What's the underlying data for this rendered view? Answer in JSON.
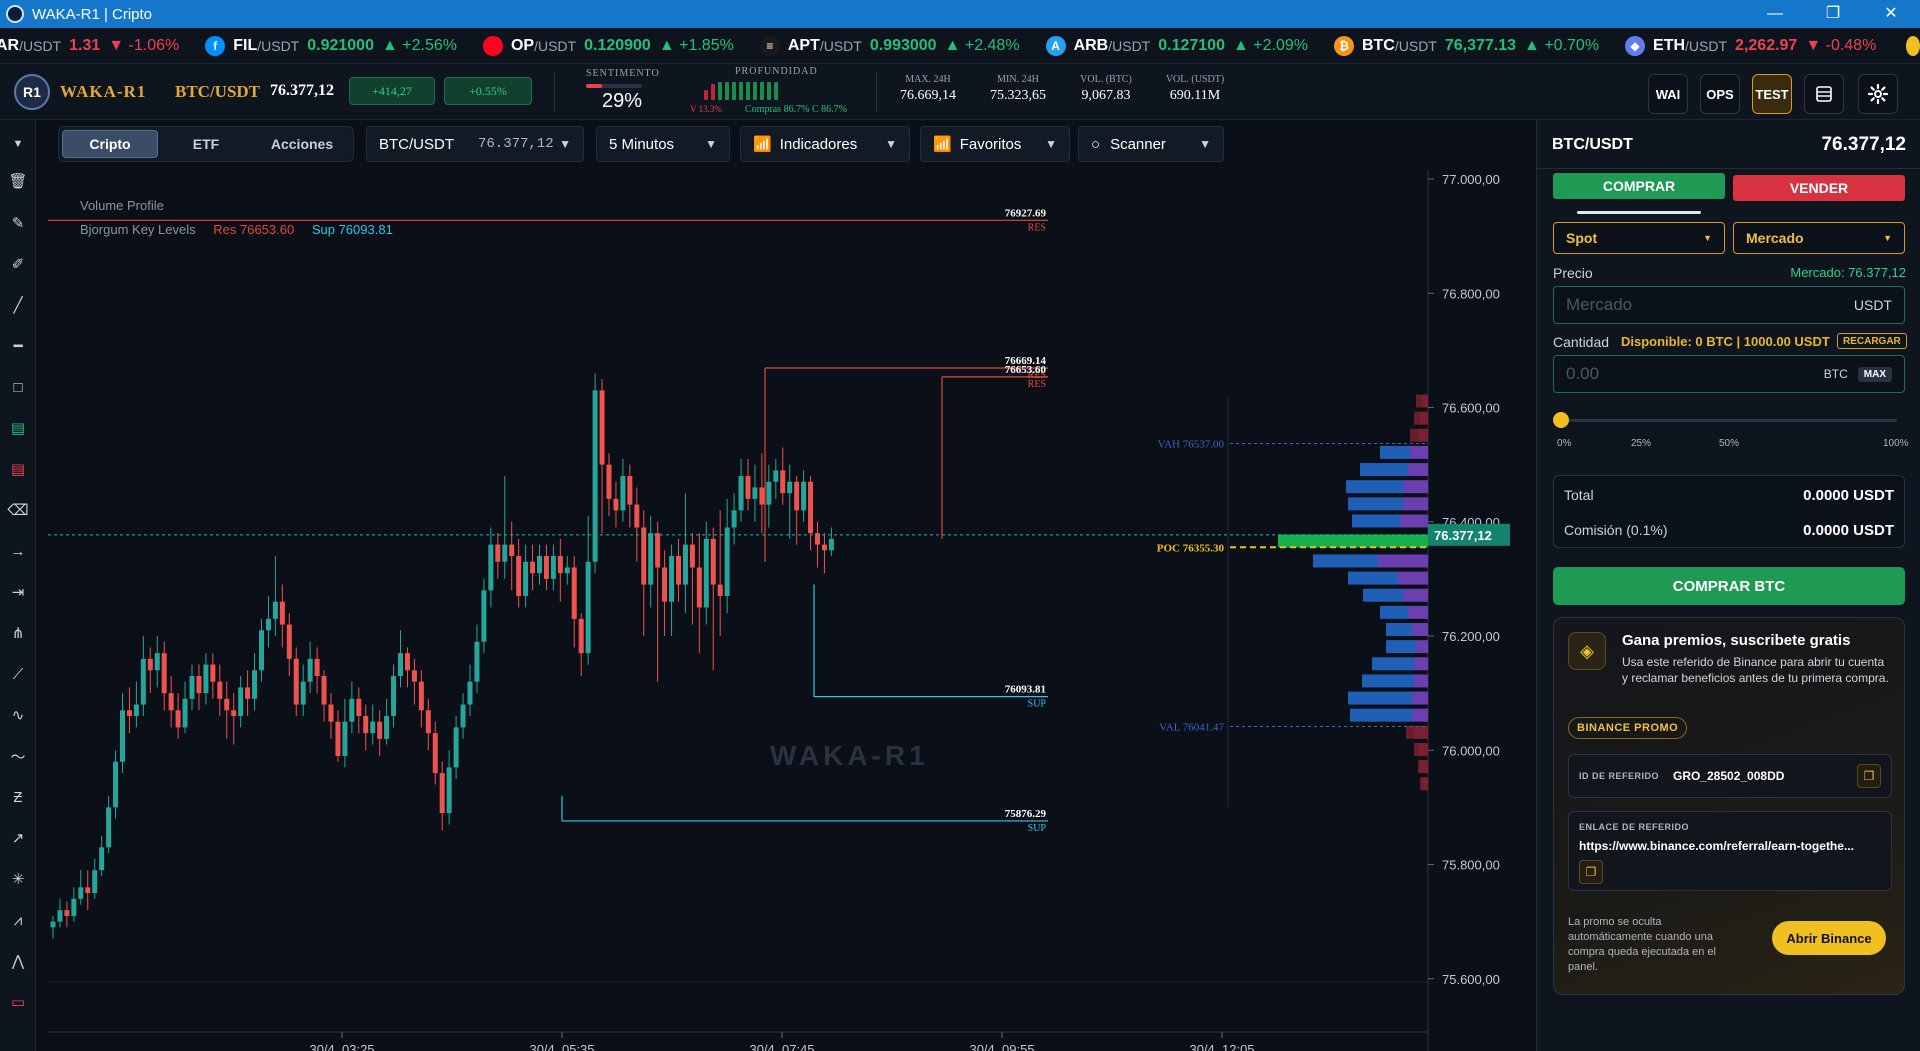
{
  "window": {
    "title": "WAKA-R1 | Cripto",
    "min": "—",
    "max": "❐",
    "close": "✕"
  },
  "ticker": [
    {
      "sym": "AR",
      "pair": "/USDT",
      "price": "1.31",
      "change": "▼ -1.06%",
      "dir": "dn",
      "color": "#333333",
      "glyph": ""
    },
    {
      "sym": "FIL",
      "pair": "/USDT",
      "price": "0.921000",
      "change": "▲ +2.56%",
      "dir": "up",
      "color": "#0090ff",
      "glyph": "f"
    },
    {
      "sym": "OP",
      "pair": "/USDT",
      "price": "0.120900",
      "change": "▲ +1.85%",
      "dir": "up",
      "color": "#ff0420",
      "glyph": ""
    },
    {
      "sym": "APT",
      "pair": "/USDT",
      "price": "0.993000",
      "change": "▲ +2.48%",
      "dir": "up",
      "color": "#1a1a1a",
      "glyph": "≡"
    },
    {
      "sym": "ARB",
      "pair": "/USDT",
      "price": "0.127100",
      "change": "▲ +2.09%",
      "dir": "up",
      "color": "#28a0f0",
      "glyph": "A"
    },
    {
      "sym": "BTC",
      "pair": "/USDT",
      "price": "76,377.13",
      "change": "▲ +0.70%",
      "dir": "up",
      "color": "#f7931a",
      "glyph": "₿"
    },
    {
      "sym": "ETH",
      "pair": "/USDT",
      "price": "2,262.97",
      "change": "▼ -0.48%",
      "dir": "dn",
      "color": "#627eea",
      "glyph": "◆"
    }
  ],
  "header": {
    "logo": "R1",
    "brand": "WAKA-R1",
    "pair": "BTC/USDT",
    "price": "76.377,12",
    "change_abs": "+414,27",
    "change_pct": "+0.55%",
    "sentiment_label": "SENTIMENTO",
    "sentiment_value": "29%",
    "sentiment_level": 0.29,
    "depth_label": "PROFUNDIDAD",
    "depth_sell": "V 13.3%",
    "depth_buy": "Compras 86.7% C 86.7%",
    "stats": [
      {
        "label": "MAX. 24H",
        "value": "76.669,14"
      },
      {
        "label": "MIN. 24H",
        "value": "75.323,65"
      },
      {
        "label": "VOL. (BTC)",
        "value": "9,067.83"
      },
      {
        "label": "VOL. (USDT)",
        "value": "690.11M"
      }
    ],
    "buttons": {
      "wai": "WAI",
      "ops": "OPS",
      "test": "TEST"
    }
  },
  "toolbar": {
    "tabs": [
      "Cripto",
      "ETF",
      "Acciones"
    ],
    "active_tab": "Cripto",
    "symbol": "BTC/USDT",
    "symbol_price": "76.377,12",
    "interval": "5 Minutos",
    "indicators": "Indicadores",
    "favorites": "Favoritos",
    "scanner": "Scanner"
  },
  "chart_data": {
    "type": "candlestick",
    "indicators": [
      "Volume Profile",
      "Bjorgum Key Levels"
    ],
    "key_levels_legend": {
      "res": "Res 76653.60",
      "sup": "Sup 76093.81"
    },
    "watermark": "WAKA-R1",
    "y_ticks": [
      "77.000,00",
      "76.800,00",
      "76.600,00",
      "76.400,00",
      "76.200,00",
      "76.000,00",
      "75.800,00",
      "75.600,00"
    ],
    "y_tick_values": [
      77000,
      76800,
      76600,
      76400,
      76200,
      76000,
      75800,
      75600
    ],
    "ylim": [
      75580,
      77010
    ],
    "x_ticks": [
      "30/4, 03:25",
      "30/4, 05:35",
      "30/4, 07:45",
      "30/4, 09:55",
      "30/4, 12:05"
    ],
    "current_price": 76377.12,
    "current_price_label": "76.377,12",
    "levels": [
      {
        "value": 76927.69,
        "label": "76927.69",
        "tag": "RES",
        "kind": "res"
      },
      {
        "value": 76669.14,
        "label": "76669.14",
        "tag": "RES",
        "kind": "res"
      },
      {
        "value": 76653.6,
        "label": "76653.60",
        "tag": "RES",
        "kind": "res"
      },
      {
        "value": 76093.81,
        "label": "76093.81",
        "tag": "SUP",
        "kind": "sup"
      },
      {
        "value": 75876.29,
        "label": "75876.29",
        "tag": "SUP",
        "kind": "sup"
      }
    ],
    "vah": {
      "value": 76537.0,
      "label": "VAH 76537.00"
    },
    "poc": {
      "value": 76355.3,
      "label": "POC 76355.30"
    },
    "val": {
      "value": 76041.47,
      "label": "VAL 76041.47"
    },
    "candles": [
      [
        75690,
        75700,
        75670,
        75710
      ],
      [
        75700,
        75720,
        75690,
        75740
      ],
      [
        75720,
        75710,
        75690,
        75735
      ],
      [
        75710,
        75740,
        75700,
        75760
      ],
      [
        75740,
        75760,
        75730,
        75790
      ],
      [
        75760,
        75750,
        75720,
        75790
      ],
      [
        75750,
        75790,
        75740,
        75810
      ],
      [
        75790,
        75830,
        75780,
        75850
      ],
      [
        75830,
        75900,
        75820,
        75920
      ],
      [
        75900,
        75980,
        75880,
        76000
      ],
      [
        75980,
        76070,
        75960,
        76100
      ],
      [
        76070,
        76060,
        76030,
        76110
      ],
      [
        76060,
        76080,
        76040,
        76120
      ],
      [
        76080,
        76160,
        76060,
        76200
      ],
      [
        76160,
        76140,
        76100,
        76180
      ],
      [
        76140,
        76170,
        76110,
        76200
      ],
      [
        76170,
        76100,
        76070,
        76190
      ],
      [
        76100,
        76070,
        76040,
        76130
      ],
      [
        76070,
        76040,
        76020,
        76100
      ],
      [
        76040,
        76090,
        76030,
        76120
      ],
      [
        76090,
        76130,
        76070,
        76150
      ],
      [
        76130,
        76100,
        76070,
        76150
      ],
      [
        76100,
        76150,
        76080,
        76170
      ],
      [
        76150,
        76120,
        76090,
        76170
      ],
      [
        76120,
        76090,
        76060,
        76150
      ],
      [
        76090,
        76070,
        76020,
        76120
      ],
      [
        76070,
        76060,
        76010,
        76100
      ],
      [
        76060,
        76110,
        76040,
        76130
      ],
      [
        76110,
        76090,
        76060,
        76140
      ],
      [
        76090,
        76140,
        76070,
        76170
      ],
      [
        76140,
        76210,
        76120,
        76230
      ],
      [
        76210,
        76230,
        76180,
        76270
      ],
      [
        76230,
        76260,
        76200,
        76340
      ],
      [
        76260,
        76220,
        76180,
        76290
      ],
      [
        76220,
        76160,
        76130,
        76240
      ],
      [
        76160,
        76080,
        76060,
        76180
      ],
      [
        76080,
        76120,
        76060,
        76150
      ],
      [
        76120,
        76160,
        76100,
        76190
      ],
      [
        76160,
        76130,
        76100,
        76180
      ],
      [
        76130,
        76080,
        76050,
        76140
      ],
      [
        76080,
        76050,
        76020,
        76100
      ],
      [
        76050,
        75990,
        75980,
        76070
      ],
      [
        75990,
        76050,
        75970,
        76090
      ],
      [
        76050,
        76090,
        76030,
        76120
      ],
      [
        76090,
        76060,
        76030,
        76110
      ],
      [
        76060,
        76030,
        76000,
        76080
      ],
      [
        76030,
        76050,
        76010,
        76080
      ],
      [
        76050,
        76020,
        75990,
        76070
      ],
      [
        76020,
        76060,
        76010,
        76090
      ],
      [
        76060,
        76130,
        76040,
        76150
      ],
      [
        76130,
        76170,
        76110,
        76210
      ],
      [
        76170,
        76140,
        76110,
        76180
      ],
      [
        76140,
        76120,
        76080,
        76160
      ],
      [
        76120,
        76070,
        76040,
        76140
      ],
      [
        76070,
        76030,
        76000,
        76090
      ],
      [
        76030,
        75960,
        75940,
        76050
      ],
      [
        75960,
        75890,
        75860,
        75980
      ],
      [
        75890,
        75970,
        75870,
        76000
      ],
      [
        75970,
        76040,
        75950,
        76060
      ],
      [
        76040,
        76080,
        76020,
        76100
      ],
      [
        76080,
        76120,
        76060,
        76150
      ],
      [
        76120,
        76190,
        76100,
        76220
      ],
      [
        76190,
        76280,
        76170,
        76300
      ],
      [
        76280,
        76360,
        76250,
        76390
      ],
      [
        76360,
        76330,
        76300,
        76380
      ],
      [
        76330,
        76360,
        76300,
        76480
      ],
      [
        76360,
        76340,
        76280,
        76400
      ],
      [
        76340,
        76270,
        76250,
        76370
      ],
      [
        76270,
        76330,
        76250,
        76360
      ],
      [
        76330,
        76310,
        76280,
        76360
      ],
      [
        76310,
        76340,
        76290,
        76360
      ],
      [
        76340,
        76300,
        76280,
        76360
      ],
      [
        76300,
        76340,
        76280,
        76360
      ],
      [
        76340,
        76310,
        76260,
        76370
      ],
      [
        76310,
        76320,
        76290,
        76340
      ],
      [
        76320,
        76230,
        76180,
        76340
      ],
      [
        76230,
        76170,
        76130,
        76240
      ],
      [
        76170,
        76330,
        76150,
        76410
      ],
      [
        76330,
        76630,
        76310,
        76660
      ],
      [
        76630,
        76500,
        76380,
        76650
      ],
      [
        76500,
        76440,
        76410,
        76520
      ],
      [
        76440,
        76420,
        76390,
        76470
      ],
      [
        76420,
        76480,
        76400,
        76510
      ],
      [
        76480,
        76430,
        76390,
        76500
      ],
      [
        76430,
        76390,
        76330,
        76460
      ],
      [
        76390,
        76290,
        76200,
        76420
      ],
      [
        76290,
        76380,
        76250,
        76410
      ],
      [
        76380,
        76320,
        76120,
        76400
      ],
      [
        76320,
        76260,
        76200,
        76350
      ],
      [
        76260,
        76340,
        76200,
        76360
      ],
      [
        76340,
        76290,
        76260,
        76370
      ],
      [
        76290,
        76360,
        76240,
        76450
      ],
      [
        76360,
        76320,
        76220,
        76380
      ],
      [
        76320,
        76250,
        76170,
        76380
      ],
      [
        76250,
        76370,
        76220,
        76400
      ],
      [
        76370,
        76290,
        76140,
        76390
      ],
      [
        76290,
        76270,
        76200,
        76420
      ],
      [
        76270,
        76390,
        76240,
        76440
      ],
      [
        76390,
        76420,
        76360,
        76450
      ],
      [
        76420,
        76480,
        76400,
        76510
      ],
      [
        76480,
        76440,
        76420,
        76510
      ],
      [
        76440,
        76460,
        76400,
        76500
      ],
      [
        76460,
        76430,
        76380,
        76520
      ],
      [
        76430,
        76470,
        76390,
        76500
      ],
      [
        76470,
        76490,
        76440,
        76510
      ],
      [
        76490,
        76450,
        76430,
        76530
      ],
      [
        76450,
        76470,
        76370,
        76500
      ],
      [
        76470,
        76420,
        76360,
        76480
      ],
      [
        76420,
        76470,
        76400,
        76490
      ],
      [
        76470,
        76380,
        76350,
        76480
      ],
      [
        76380,
        76360,
        76320,
        76400
      ],
      [
        76360,
        76350,
        76310,
        76380
      ],
      [
        76350,
        76370,
        76340,
        76390
      ]
    ],
    "volume_profile": [
      {
        "price": 76600,
        "buy": 6,
        "sell": 6
      },
      {
        "price": 76570,
        "buy": 6,
        "sell": 8
      },
      {
        "price": 76540,
        "buy": 8,
        "sell": 10
      },
      {
        "price": 76510,
        "buy": 30,
        "sell": 18
      },
      {
        "price": 76480,
        "buy": 48,
        "sell": 20
      },
      {
        "price": 76450,
        "buy": 58,
        "sell": 24
      },
      {
        "price": 76420,
        "buy": 55,
        "sell": 25
      },
      {
        "price": 76390,
        "buy": 48,
        "sell": 28
      },
      {
        "price": 76355,
        "buy": 130,
        "sell": 20
      },
      {
        "price": 76320,
        "buy": 65,
        "sell": 50
      },
      {
        "price": 76290,
        "buy": 50,
        "sell": 30
      },
      {
        "price": 76260,
        "buy": 40,
        "sell": 25
      },
      {
        "price": 76230,
        "buy": 28,
        "sell": 20
      },
      {
        "price": 76200,
        "buy": 26,
        "sell": 16
      },
      {
        "price": 76170,
        "buy": 30,
        "sell": 12
      },
      {
        "price": 76140,
        "buy": 42,
        "sell": 14
      },
      {
        "price": 76110,
        "buy": 52,
        "sell": 14
      },
      {
        "price": 76080,
        "buy": 64,
        "sell": 16
      },
      {
        "price": 76050,
        "buy": 62,
        "sell": 16
      },
      {
        "price": 76020,
        "buy": 8,
        "sell": 14
      },
      {
        "price": 75990,
        "buy": 4,
        "sell": 10
      },
      {
        "price": 75960,
        "buy": 2,
        "sell": 8
      },
      {
        "price": 75930,
        "buy": 2,
        "sell": 6
      }
    ]
  },
  "order_panel": {
    "pair": "BTC/USDT",
    "price": "76.377,12",
    "buy_tab": "COMPRAR",
    "sell_tab": "VENDER",
    "type_select": "Spot",
    "order_select": "Mercado",
    "price_label": "Precio",
    "market_label": "Mercado: 76.377,12",
    "price_placeholder": "Mercado",
    "price_unit": "USDT",
    "qty_label": "Cantidad",
    "available": "Disponible: 0 BTC | 1000.00 USDT",
    "recharge": "RECARGAR",
    "qty_placeholder": "0.00",
    "qty_unit": "BTC",
    "max": "MAX",
    "slider_level": 0,
    "slider_ticks": [
      "0%",
      "25%",
      "50%",
      "100%"
    ],
    "total_label": "Total",
    "total_value": "0.0000 USDT",
    "fee_label": "Comisión (0.1%)",
    "fee_value": "0.0000 USDT",
    "submit": "COMPRAR BTC"
  },
  "promo": {
    "title": "Gana premios, suscribete gratis",
    "desc": "Usa este referido de Binance para abrir tu cuenta y reclamar beneficios antes de tu primera compra.",
    "badge": "BINANCE PROMO",
    "ref_id_label": "ID DE REFERIDO",
    "ref_id": "GRO_28502_008DD",
    "ref_link_label": "ENLACE DE REFERIDO",
    "ref_link": "https://www.binance.com/referral/earn-togethe...",
    "note": "La promo se oculta automáticamente cuando una compra queda ejecutada en el panel.",
    "open": "Abrir Binance"
  }
}
